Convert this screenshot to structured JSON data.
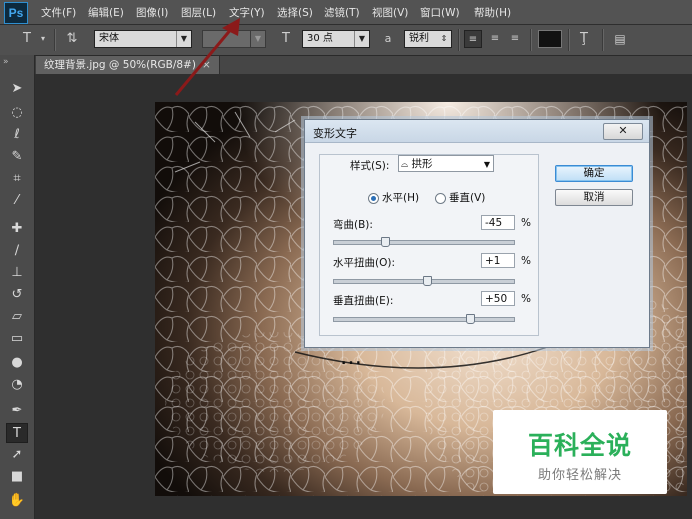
{
  "app": {
    "logo": "Ps"
  },
  "menu": [
    "文件(F)",
    "编辑(E)",
    "图像(I)",
    "图层(L)",
    "文字(Y)",
    "选择(S)",
    "滤镜(T)",
    "视图(V)",
    "窗口(W)",
    "帮助(H)"
  ],
  "options_bar": {
    "tool_icon": "text-tool-icon",
    "orientation_icon": "text-orientation-icon",
    "font_family": "宋体",
    "font_style": "",
    "font_size": "30 点",
    "aa_icon": "a",
    "antialias": "锐利",
    "color_swatch": "#111111"
  },
  "doc_tab": {
    "title": "纹理背景.jpg @ 50%(RGB/8#)",
    "close": "×"
  },
  "tools": [
    "move-icon",
    "marquee-icon",
    "lasso-icon",
    "quick-select-icon",
    "crop-icon",
    "eyedropper-icon",
    "healing-icon",
    "brush-icon",
    "stamp-icon",
    "history-brush-icon",
    "eraser-icon",
    "gradient-icon",
    "blur-icon",
    "dodge-icon",
    "pen-icon",
    "type-icon",
    "path-select-icon",
    "shape-icon",
    "hand-icon"
  ],
  "canvas_text": "…",
  "dialog": {
    "title": "变形文字",
    "close": "✕",
    "style_label": "样式(S):",
    "style_value": "拱形",
    "horizontal_label": "水平(H)",
    "vertical_label": "垂直(V)",
    "orientation_selected": "horizontal",
    "bend_label": "弯曲(B):",
    "bend_value": "-45",
    "hdist_label": "水平扭曲(O):",
    "hdist_value": "+1",
    "vdist_label": "垂直扭曲(E):",
    "vdist_value": "+50",
    "percent": "%",
    "ok_label": "确定",
    "cancel_label": "取消"
  },
  "watermark": {
    "main": "百科全说",
    "sub": "助你轻松解决"
  }
}
